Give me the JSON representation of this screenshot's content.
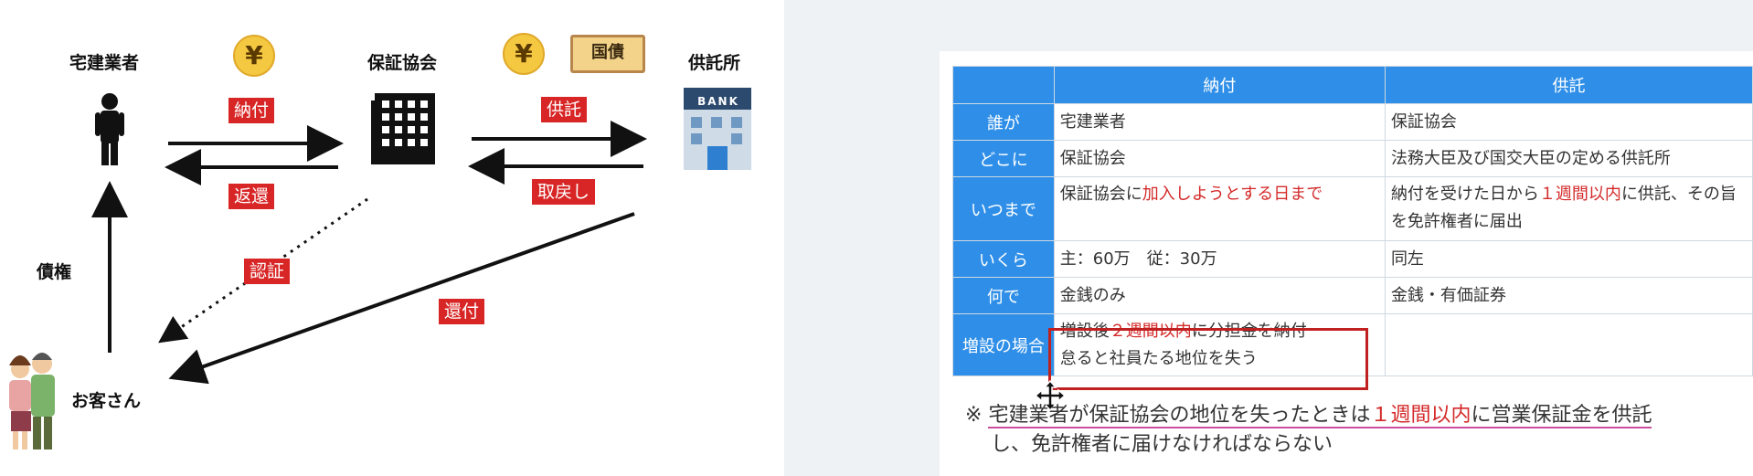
{
  "diagram": {
    "actors": {
      "dealer": "宅建業者",
      "association": "保証協会",
      "depository": "供託所",
      "customer": "お客さん"
    },
    "flows": {
      "payment": "納付",
      "return": "返還",
      "deposit": "供託",
      "withdraw": "取戻し",
      "certify": "認証",
      "refund": "還付",
      "claim": "債権"
    },
    "icons": {
      "yen_symbol": "¥",
      "bond_label": "国債",
      "bank_label": "BANK"
    },
    "colors": {
      "tag_red": "#d82626",
      "coin_gold": "#f5c842"
    }
  },
  "table": {
    "headers": [
      "",
      "納付",
      "供託"
    ],
    "rows": [
      {
        "label": "誰が",
        "payment": "宅建業者",
        "deposit": "保証協会"
      },
      {
        "label": "どこに",
        "payment": "保証協会",
        "deposit": "法務大臣及び国交大臣の定める供託所"
      },
      {
        "label": "いつまで",
        "payment_pre": "保証協会に",
        "payment_hl": "加入しようとする日まで",
        "deposit_pre": "納付を受けた日から",
        "deposit_hl": "１週間以内",
        "deposit_post": "に供託、その旨を免許権者に届出"
      },
      {
        "label": "いくら",
        "payment": "主：60万　従：30万",
        "deposit": "同左"
      },
      {
        "label": "何で",
        "payment": "金銭のみ",
        "deposit": "金銭・有価証券"
      },
      {
        "label": "増設の場合",
        "payment_pre": "増設後",
        "payment_hl": "２週間以内",
        "payment_post": "に分担金を納付",
        "payment_line2": "怠ると社員たる地位を失う",
        "deposit": ""
      }
    ],
    "colors": {
      "header_blue": "#2f8fe8",
      "highlight_red": "#d42a2a"
    }
  },
  "note": {
    "mark": "※",
    "pre": "宅建業者が保証協会の地位を失ったときは",
    "hl": "１週間以内",
    "post1": "に営業保証金を供託",
    "post2": "し、免許権者に届けなければならない"
  }
}
